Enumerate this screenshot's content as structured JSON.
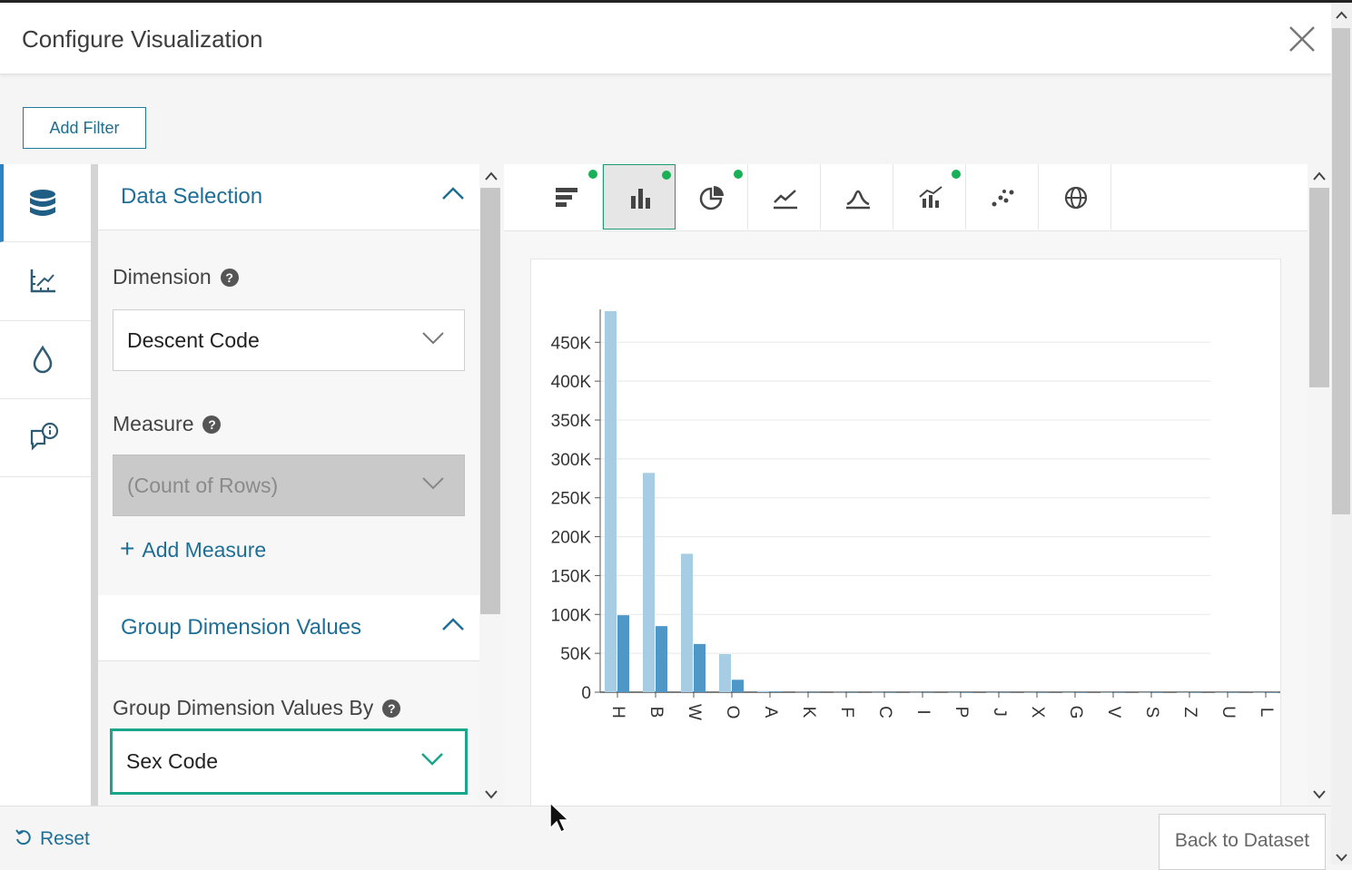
{
  "window": {
    "title": "Configure Visualization"
  },
  "toolbar": {
    "add_filter_label": "Add Filter"
  },
  "sidebar": {
    "icons": [
      "database-icon",
      "axis-chart-icon",
      "droplet-icon",
      "chat-info-icon"
    ],
    "active": "database-icon"
  },
  "panel": {
    "data_selection": {
      "title": "Data Selection",
      "dimension_label": "Dimension",
      "dimension_value": "Descent Code",
      "measure_label": "Measure",
      "measure_value": "(Count of Rows)",
      "add_measure_label": "Add Measure"
    },
    "group_values": {
      "title": "Group Dimension Values",
      "group_by_label": "Group Dimension Values By",
      "group_by_value": "Sex Code"
    }
  },
  "chart_tabs": [
    {
      "icon": "horizontal-bar-chart-icon",
      "badge": true
    },
    {
      "icon": "column-chart-icon",
      "badge": true,
      "active": true
    },
    {
      "icon": "pie-chart-icon",
      "badge": true
    },
    {
      "icon": "line-chart-icon",
      "badge": false
    },
    {
      "icon": "area-chart-icon",
      "badge": false
    },
    {
      "icon": "combo-chart-icon",
      "badge": true
    },
    {
      "icon": "scatter-chart-icon",
      "badge": false
    },
    {
      "icon": "map-globe-icon",
      "badge": false
    }
  ],
  "chart_data": {
    "type": "bar",
    "categories": [
      "H",
      "B",
      "W",
      "O",
      "A",
      "K",
      "F",
      "C",
      "I",
      "P",
      "J",
      "X",
      "G",
      "V",
      "S",
      "Z",
      "U",
      "L"
    ],
    "series": [
      {
        "values": [
          490000,
          282000,
          178000,
          49000,
          1500,
          300,
          200,
          150,
          100,
          80,
          60,
          50,
          40,
          30,
          20,
          15,
          10,
          5
        ]
      },
      {
        "values": [
          99000,
          85000,
          62000,
          16000,
          900,
          200,
          150,
          100,
          80,
          60,
          40,
          30,
          25,
          20,
          15,
          10,
          8,
          4
        ]
      }
    ],
    "colors": [
      "#a6cde3",
      "#4f97c6"
    ],
    "ylim": [
      0,
      490000
    ],
    "yticks": [
      0,
      50000,
      100000,
      150000,
      200000,
      250000,
      300000,
      350000,
      400000,
      450000
    ],
    "ytick_labels": [
      "0",
      "50K",
      "100K",
      "150K",
      "200K",
      "250K",
      "300K",
      "350K",
      "400K",
      "450K"
    ],
    "grid": true,
    "xlabel": "",
    "ylabel": ""
  },
  "footer": {
    "reset_label": "Reset",
    "back_label": "Back to Dataset"
  }
}
